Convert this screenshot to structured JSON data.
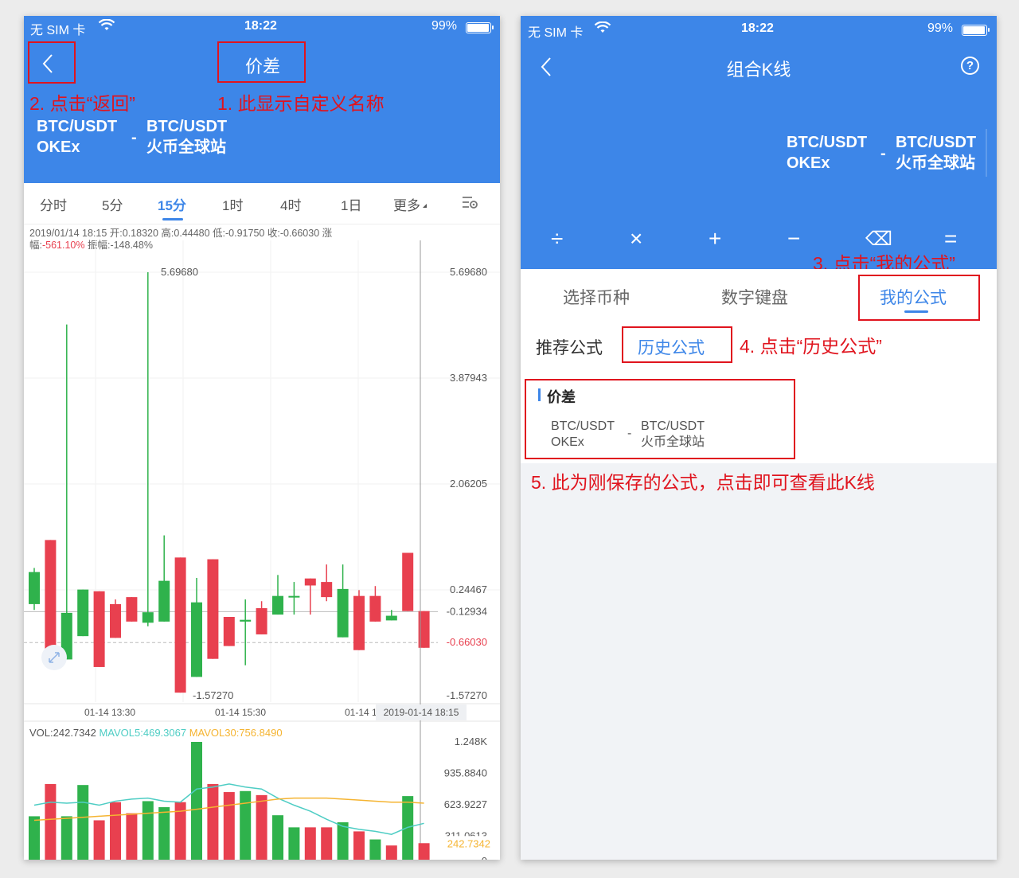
{
  "left": {
    "status": {
      "carrier": "无 SIM 卡",
      "time": "18:22",
      "battery": "99%"
    },
    "title": "价差",
    "pair": {
      "a_symbol": "BTC/USDT",
      "a_exchange": "OKEx",
      "b_symbol": "BTC/USDT",
      "b_exchange": "火币全球站",
      "minus": "-"
    },
    "tabs": [
      "分时",
      "5分",
      "15分",
      "1时",
      "4时",
      "1日",
      "更多"
    ],
    "active_tab": "15分",
    "info_line1": "2019/01/14 18:15 开:0.18320 高:0.44480 低:-0.91750 收:-0.66030 涨",
    "info_line2_prefix": "幅:",
    "info_change": "-561.10%",
    "info_line2_suffix": " 振幅:-148.48%",
    "high_label": "5.69680",
    "low_label": "-1.57270",
    "y_labels": [
      "5.69680",
      "3.87943",
      "2.06205",
      "0.24467",
      "-0.12934",
      "-0.66030",
      "-1.57270"
    ],
    "x_labels": [
      "01-14 13:30",
      "01-14 15:30",
      "01-14 1"
    ],
    "x_current": "2019-01-14 18:15",
    "vol_prefix": "VOL:242.7342",
    "mavol5": "MAVOL5:469.3067",
    "mavol30": "MAVOL30:756.8490",
    "vol_y_labels": [
      "1.248K",
      "935.8840",
      "623.9227",
      "311.0613",
      "0"
    ],
    "vol_current": "242.7342",
    "colors": {
      "up": "#2fb24c",
      "down": "#e8404f",
      "blue": "#3d86e8",
      "ma5": "#4ecdc4",
      "ma30": "#f5b431"
    }
  },
  "right": {
    "status": {
      "carrier": "无 SIM 卡",
      "time": "18:22",
      "battery": "99%"
    },
    "title": "组合K线",
    "help": "?",
    "pair": {
      "a_symbol": "BTC/USDT",
      "a_exchange": "OKEx",
      "b_symbol": "BTC/USDT",
      "b_exchange": "火币全球站",
      "minus": "-"
    },
    "keys": [
      "÷",
      "×",
      "+",
      "−",
      "⌫",
      "="
    ],
    "tabs": [
      "选择币种",
      "数字键盘",
      "我的公式"
    ],
    "subtabs": [
      "推荐公式",
      "历史公式"
    ],
    "formula": {
      "name": "价差",
      "a_symbol": "BTC/USDT",
      "a_exchange": "OKEx",
      "b_symbol": "BTC/USDT",
      "b_exchange": "火币全球站",
      "minus": "-"
    }
  },
  "annotations": {
    "a1": "1. 此显示自定义名称",
    "a2": "2. 点击“返回”",
    "a3": "3. 点击“我的公式”",
    "a4": "4. 点击“历史公式”",
    "a5": "5. 此为刚保存的公式，点击即可查看此K线"
  },
  "chart_data": {
    "type": "candlestick",
    "y_range": [
      -1.5727,
      5.6968
    ],
    "candles": [
      {
        "o": 0.55,
        "c": 0.0,
        "h": 0.62,
        "l": -0.1,
        "dir": "up"
      },
      {
        "o": 1.1,
        "c": -1.05,
        "h": 1.1,
        "l": -1.05,
        "dir": "down"
      },
      {
        "o": -0.15,
        "c": -0.95,
        "h": 4.8,
        "l": -0.95,
        "dir": "up"
      },
      {
        "o": 0.25,
        "c": -0.55,
        "h": 0.25,
        "l": -0.55,
        "dir": "up"
      },
      {
        "o": 0.22,
        "c": -1.08,
        "h": 0.22,
        "l": -1.08,
        "dir": "down"
      },
      {
        "o": 0.0,
        "c": -0.58,
        "h": 0.08,
        "l": -0.58,
        "dir": "down"
      },
      {
        "o": 0.12,
        "c": -0.3,
        "h": 0.12,
        "l": -0.3,
        "dir": "down"
      },
      {
        "o": -0.14,
        "c": -0.32,
        "h": 5.6968,
        "l": -0.38,
        "dir": "up"
      },
      {
        "o": 0.4,
        "c": -0.3,
        "h": 1.18,
        "l": -0.3,
        "dir": "up"
      },
      {
        "o": 0.8,
        "c": -1.52,
        "h": 0.8,
        "l": -1.52,
        "dir": "down"
      },
      {
        "o": 0.03,
        "c": -1.25,
        "h": 0.45,
        "l": -1.25,
        "dir": "up"
      },
      {
        "o": 0.77,
        "c": -0.94,
        "h": 0.77,
        "l": -0.94,
        "dir": "down"
      },
      {
        "o": -0.22,
        "c": -0.72,
        "h": -0.22,
        "l": -0.72,
        "dir": "down"
      },
      {
        "o": -0.27,
        "c": -0.3,
        "h": 0.08,
        "l": -1.05,
        "dir": "up"
      },
      {
        "o": -0.07,
        "c": -0.52,
        "h": 0.05,
        "l": -0.52,
        "dir": "down"
      },
      {
        "o": 0.14,
        "c": -0.18,
        "h": 0.5,
        "l": -0.18,
        "dir": "up"
      },
      {
        "o": 0.14,
        "c": 0.12,
        "h": 0.38,
        "l": -0.18,
        "dir": "up"
      },
      {
        "o": 0.44,
        "c": 0.32,
        "h": 0.44,
        "l": -0.18,
        "dir": "down"
      },
      {
        "o": 0.38,
        "c": 0.12,
        "h": 0.68,
        "l": 0.05,
        "dir": "down"
      },
      {
        "o": 0.26,
        "c": -0.57,
        "h": 0.68,
        "l": -0.57,
        "dir": "up"
      },
      {
        "o": 0.14,
        "c": -0.79,
        "h": 0.24,
        "l": -0.79,
        "dir": "down"
      },
      {
        "o": 0.14,
        "c": -0.3,
        "h": 0.31,
        "l": -0.3,
        "dir": "down"
      },
      {
        "o": -0.2,
        "c": -0.28,
        "h": -0.1,
        "l": -0.28,
        "dir": "up"
      },
      {
        "o": 0.88,
        "c": -0.12,
        "h": 0.88,
        "l": -0.12,
        "dir": "down"
      },
      {
        "o": -0.12,
        "c": -0.75,
        "h": -0.12,
        "l": -0.75,
        "dir": "down"
      }
    ],
    "volumes": [
      {
        "v": 510,
        "dir": "up"
      },
      {
        "v": 830,
        "dir": "down"
      },
      {
        "v": 510,
        "dir": "up"
      },
      {
        "v": 820,
        "dir": "up"
      },
      {
        "v": 470,
        "dir": "down"
      },
      {
        "v": 650,
        "dir": "down"
      },
      {
        "v": 540,
        "dir": "down"
      },
      {
        "v": 660,
        "dir": "up"
      },
      {
        "v": 600,
        "dir": "up"
      },
      {
        "v": 650,
        "dir": "down"
      },
      {
        "v": 1248,
        "dir": "up"
      },
      {
        "v": 830,
        "dir": "down"
      },
      {
        "v": 750,
        "dir": "down"
      },
      {
        "v": 760,
        "dir": "up"
      },
      {
        "v": 720,
        "dir": "down"
      },
      {
        "v": 520,
        "dir": "up"
      },
      {
        "v": 400,
        "dir": "up"
      },
      {
        "v": 400,
        "dir": "down"
      },
      {
        "v": 400,
        "dir": "down"
      },
      {
        "v": 450,
        "dir": "up"
      },
      {
        "v": 360,
        "dir": "down"
      },
      {
        "v": 280,
        "dir": "up"
      },
      {
        "v": 220,
        "dir": "down"
      },
      {
        "v": 710,
        "dir": "up"
      },
      {
        "v": 242.7342,
        "dir": "down"
      }
    ],
    "mavol5_line": [
      620,
      650,
      640,
      650,
      620,
      660,
      680,
      690,
      660,
      650,
      780,
      800,
      830,
      800,
      780,
      690,
      620,
      560,
      480,
      410,
      380,
      360,
      330,
      400,
      440
    ],
    "mavol30_line": [
      470,
      480,
      490,
      500,
      510,
      520,
      530,
      540,
      550,
      560,
      580,
      600,
      620,
      640,
      660,
      680,
      690,
      690,
      690,
      680,
      670,
      660,
      650,
      650,
      640
    ],
    "vol_range": [
      0,
      1248
    ]
  }
}
